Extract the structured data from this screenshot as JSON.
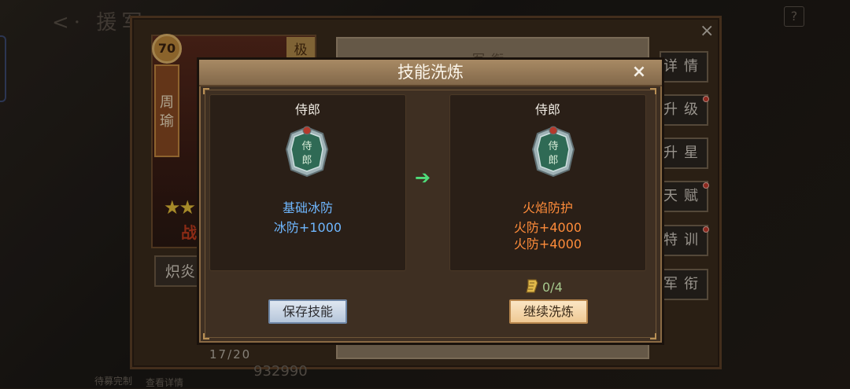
{
  "background": {
    "title": "援军",
    "close_glyph": "×",
    "help_glyph": "?",
    "hero": {
      "level": "70",
      "name": "周瑜",
      "rank_tag": "极",
      "stars": "★★",
      "zhan": "战",
      "skill_bar": "炽炎",
      "count": "17/20",
      "power": "932990"
    },
    "tab_title": "军衔",
    "side_buttons": [
      "详情",
      "升级",
      "升星",
      "天赋",
      "特训",
      "军衔"
    ],
    "bottom_left_1": "待募完制",
    "bottom_left_2": "查看详情"
  },
  "modal": {
    "title": "技能洗炼",
    "close_glyph": "×",
    "left": {
      "name": "侍郎",
      "icon_text": "侍郎",
      "skill_name": "基础冰防",
      "stats": [
        "冰防+1000"
      ]
    },
    "right": {
      "name": "侍郎",
      "icon_text": "侍郎",
      "skill_name": "火焰防护",
      "stats": [
        "火防+4000",
        "火防+4000"
      ]
    },
    "arrow_glyph": "➔",
    "cost": "0/4",
    "save_button": "保存技能",
    "continue_button": "继续洗炼",
    "colors": {
      "current_skill": "#6fb7ff",
      "new_skill": "#ff8c3a",
      "arrow": "#4fdc7a"
    }
  }
}
